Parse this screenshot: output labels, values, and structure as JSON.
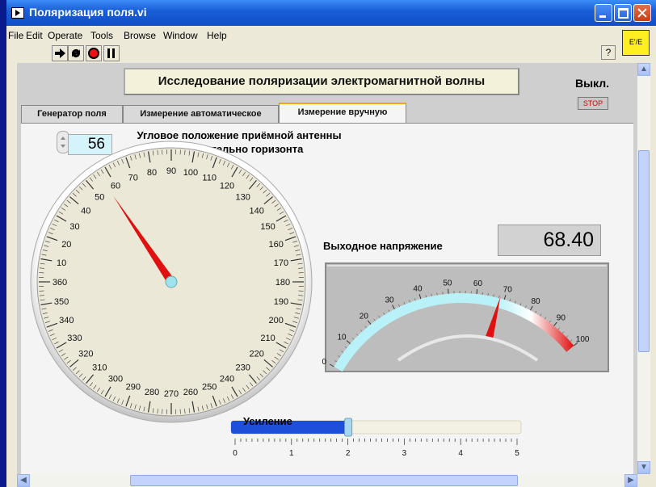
{
  "window": {
    "title": "Поляризация поля.vi"
  },
  "menu": [
    "File",
    "Edit",
    "Operate",
    "Tools",
    "Browse",
    "Window",
    "Help"
  ],
  "toolbar": {
    "help_glyph": "?",
    "ctx_glyph": "E'/E"
  },
  "header": {
    "title": "Исследование поляризации электромагнитной волны"
  },
  "power": {
    "label": "Выкл.",
    "stop_label": "STOP"
  },
  "tabs": [
    {
      "label": "Генератор поля",
      "active": false
    },
    {
      "label": "Измерение автоматическое",
      "active": false
    },
    {
      "label": "Измерение вручную",
      "active": true
    }
  ],
  "angle": {
    "title_line1": "Угловое положение приёмной антенны",
    "title_line2": "относительно горизонта",
    "value": "56",
    "dial_labels": [
      "60",
      "70",
      "80",
      "90",
      "100",
      "110",
      "120",
      "130",
      "140",
      "150",
      "160",
      "170",
      "180",
      "190",
      "200",
      "210",
      "220",
      "230",
      "240",
      "250",
      "260",
      "270",
      "280",
      "290",
      "300",
      "310",
      "320",
      "330",
      "340",
      "350",
      "360",
      "10",
      "20",
      "30",
      "40",
      "50"
    ],
    "needle_value": 56
  },
  "output": {
    "label": "Выходное напряжение",
    "value": "68.40",
    "scale_labels": [
      "0",
      "10",
      "20",
      "30",
      "40",
      "50",
      "60",
      "70",
      "80",
      "90",
      "100"
    ],
    "needle_value": 68.4
  },
  "gain": {
    "title": "Усиление",
    "scale_labels": [
      "0",
      "1",
      "2",
      "3",
      "4",
      "5"
    ],
    "value": 2.0,
    "min": 0,
    "max": 5
  },
  "colors": {
    "accent_blue": "#1d4fd8",
    "gauge_track": "#b8f2f8",
    "needle_red": "#e01010",
    "dial_face": "#ebe8d8"
  }
}
